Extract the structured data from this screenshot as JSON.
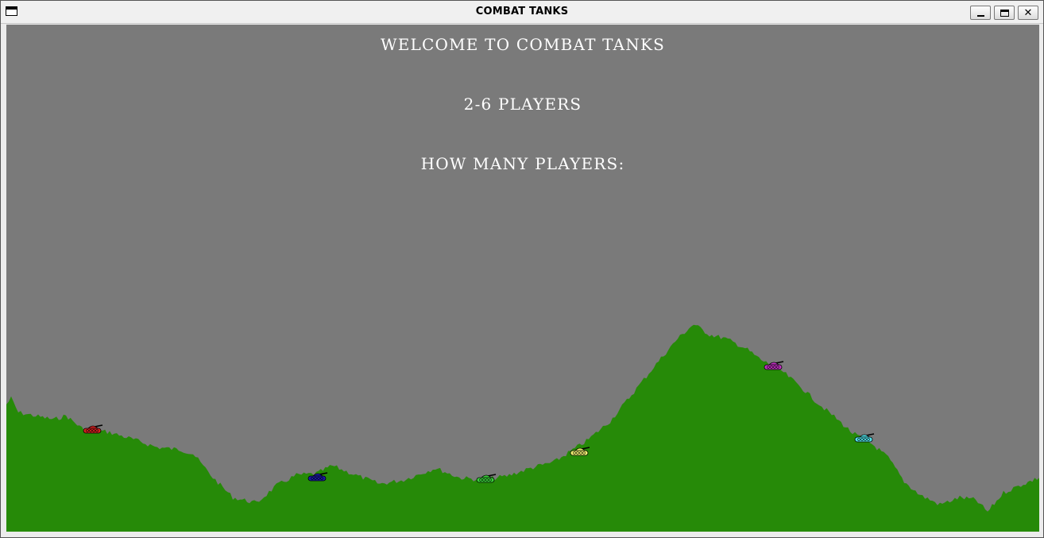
{
  "window": {
    "title": "COMBAT TANKS",
    "icon": "window-icon",
    "controls": [
      "minimize",
      "maximize",
      "close"
    ],
    "close_label": "✕"
  },
  "game": {
    "welcome": "WELCOME TO COMBAT TANKS",
    "players_range": "2-6 PLAYERS",
    "prompt": "HOW MANY PLAYERS:",
    "sky_color": "#7a7a7a",
    "ground_color": "#268a08",
    "tanks": [
      {
        "color": "#d42020",
        "name": "red-tank"
      },
      {
        "color": "#1a1aa8",
        "name": "blue-tank"
      },
      {
        "color": "#38d038",
        "name": "green-tank"
      },
      {
        "color": "#f0f070",
        "name": "yellow-tank"
      },
      {
        "color": "#c030c0",
        "name": "magenta-tank"
      },
      {
        "color": "#50e0e8",
        "name": "cyan-tank"
      }
    ]
  }
}
